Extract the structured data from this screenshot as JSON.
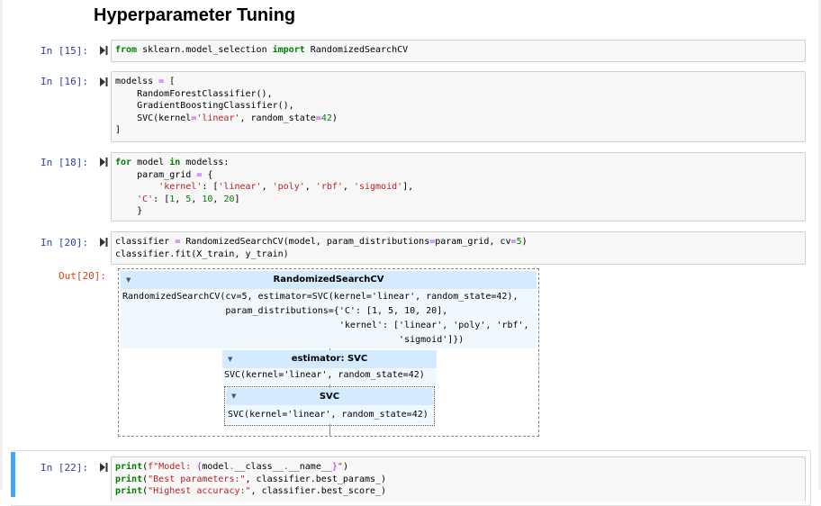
{
  "heading": "Hyperparameter Tuning",
  "icons": {
    "run": "run-cell-icon",
    "toggle": "triangle-down-icon"
  },
  "colors": {
    "prompt_in": "#303f9f",
    "prompt_out": "#d84315",
    "keyword": "#008000",
    "string": "#ba2121",
    "number": "#008000",
    "operator": "#aa22ff",
    "estimator_header": "#d4ebff",
    "active_cell_bar": "#42a5f5"
  },
  "cells": [
    {
      "prompt": "In [15]:"
    },
    {
      "prompt": "In [16]:"
    },
    {
      "prompt": "In [18]:"
    },
    {
      "prompt": "In [20]:",
      "out_prompt": "Out[20]:"
    },
    {
      "prompt": "In [22]:"
    }
  ],
  "code": {
    "c15": {
      "from": "from",
      "mod": " sklearn.model_selection ",
      "import": "import",
      "name": " RandomizedSearchCV"
    },
    "c16": {
      "l1a": "modelss ",
      "l1b": "=",
      "l1c": " [",
      "l2": "    RandomForestClassifier(),",
      "l3": "    GradientBoostingClassifier(),",
      "l4a": "    SVC(kernel",
      "l4b": "=",
      "l4c": "'linear'",
      "l4d": ", random_state",
      "l4e": "=",
      "l4f": "42",
      "l4g": ")",
      "l5": "]"
    },
    "c18": {
      "l1a": "for",
      "l1b": " model ",
      "l1c": "in",
      "l1d": " modelss:",
      "l2a": "    param_grid ",
      "l2b": "=",
      "l2c": " {",
      "l3a": "        ",
      "l3b": "'kernel'",
      "l3c": ": [",
      "l3d": "'linear'",
      "l3e": ", ",
      "l3f": "'poly'",
      "l3g": ", ",
      "l3h": "'rbf'",
      "l3i": ", ",
      "l3j": "'sigmoid'",
      "l3k": "],",
      "l4a": "    ",
      "l4b": "'C'",
      "l4c": ": [",
      "l4d": "1",
      "l4e": ", ",
      "l4f": "5",
      "l4g": ", ",
      "l4h": "10",
      "l4i": ", ",
      "l4j": "20",
      "l4k": "]",
      "l5": "    }"
    },
    "c20": {
      "l1a": "classifier ",
      "l1b": "=",
      "l1c": " RandomizedSearchCV(model, param_distributions",
      "l1d": "=",
      "l1e": "param_grid, cv",
      "l1f": "=",
      "l1g": "5",
      "l1h": ")",
      "l2": "classifier.fit(X_train, y_train)"
    },
    "c22": {
      "l1a": "print",
      "l1b": "(",
      "l1c": "f\"Model: ",
      "l1d": "{",
      "l1e": "model",
      "l1f": ".",
      "l1g": "__class__",
      "l1h": ".",
      "l1i": "__name__",
      "l1j": "}",
      "l1k": "\"",
      "l1l": ")",
      "l2a": "print",
      "l2b": "(",
      "l2c": "\"Best parameters:\"",
      "l2d": ", classifier.best_params_)",
      "l3a": "print",
      "l3b": "(",
      "l3c": "\"Highest accuracy:\"",
      "l3d": ", classifier.best_score_)"
    }
  },
  "output": {
    "outer_title": "RandomizedSearchCV",
    "outer_body": "RandomizedSearchCV(cv=5, estimator=SVC(kernel='linear', random_state=42),\n                   param_distributions={'C': [1, 5, 10, 20],\n                                        'kernel': ['linear', 'poly', 'rbf',\n                                                   'sigmoid']})",
    "estimator_title": "estimator: SVC",
    "estimator_body": "SVC(kernel='linear', random_state=42)",
    "svc_title": "SVC",
    "svc_body": "SVC(kernel='linear', random_state=42)"
  }
}
